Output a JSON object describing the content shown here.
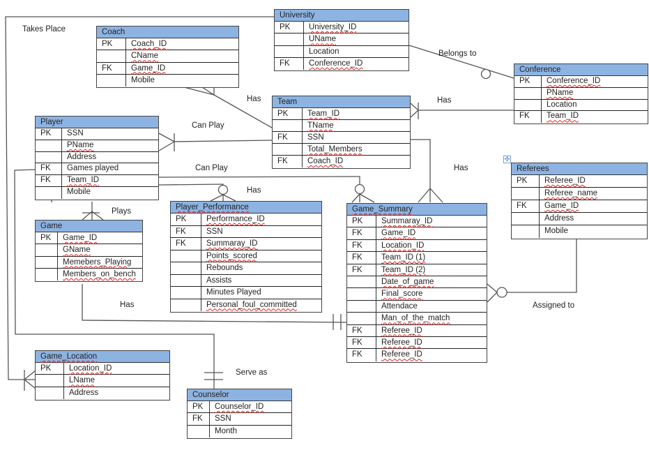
{
  "tables": [
    {
      "id": "university",
      "title": "University",
      "rows": [
        [
          "PK",
          "University_ID"
        ],
        [
          "",
          "UName"
        ],
        [
          "",
          "Location"
        ],
        [
          "FK",
          "Conference_ID"
        ]
      ]
    },
    {
      "id": "coach",
      "title": "Coach",
      "rows": [
        [
          "PK",
          "Coach_ID"
        ],
        [
          "",
          "CName"
        ],
        [
          "FK",
          "Game_ID"
        ],
        [
          "",
          "Mobile"
        ]
      ]
    },
    {
      "id": "conference",
      "title": "Conference",
      "rows": [
        [
          "PK",
          "Conference_ID"
        ],
        [
          "",
          "PName"
        ],
        [
          "",
          "Location"
        ],
        [
          "FK",
          "Team_ID"
        ]
      ]
    },
    {
      "id": "team",
      "title": "Team",
      "rows": [
        [
          "PK",
          "Team_ID"
        ],
        [
          "",
          "TName"
        ],
        [
          "FK",
          "SSN"
        ],
        [
          "",
          "Total_Members"
        ],
        [
          "FK",
          "Coach_ID"
        ]
      ]
    },
    {
      "id": "player",
      "title": "Player",
      "rows": [
        [
          "PK",
          "SSN"
        ],
        [
          "",
          "PName"
        ],
        [
          "",
          "Address"
        ],
        [
          "FK",
          "Games played"
        ],
        [
          "FK",
          "Team_ID"
        ],
        [
          "",
          "Mobile"
        ]
      ]
    },
    {
      "id": "referees",
      "title": "Referees",
      "rows": [
        [
          "PK",
          "Referee_ID"
        ],
        [
          "",
          "Referee_name"
        ],
        [
          "FK",
          "Game_ID"
        ],
        [
          "",
          "Address"
        ],
        [
          "",
          "Mobile"
        ]
      ]
    },
    {
      "id": "player-performance",
      "title": "Player_Performance",
      "rows": [
        [
          "PK",
          "Performance_ID"
        ],
        [
          "FK",
          "SSN"
        ],
        [
          "FK",
          "Summaray_ID"
        ],
        [
          "",
          "Points_scored"
        ],
        [
          "",
          "Rebounds"
        ],
        [
          "",
          "Assists"
        ],
        [
          "",
          "Minutes Played"
        ],
        [
          "",
          "Personal_foul_committed"
        ]
      ]
    },
    {
      "id": "game-summary",
      "title": "Game_Summary",
      "rows": [
        [
          "PK",
          "Summaray_ID"
        ],
        [
          "FK",
          "Game_ID"
        ],
        [
          "FK",
          "Location_ID"
        ],
        [
          "FK",
          "Team_ID (1)"
        ],
        [
          "FK",
          "Team_ID (2)"
        ],
        [
          "",
          "Date_of_game"
        ],
        [
          "",
          "Final_score"
        ],
        [
          "",
          "Attendace"
        ],
        [
          "",
          "Man_of_the_match"
        ],
        [
          "FK",
          "Referee_ID"
        ],
        [
          "FK",
          "Referee_ID"
        ],
        [
          "FK",
          "Referee_ID"
        ]
      ]
    },
    {
      "id": "game",
      "title": "Game",
      "rows": [
        [
          "PK",
          "Game_ID"
        ],
        [
          "",
          "GName"
        ],
        [
          "",
          "Memebers_Playing"
        ],
        [
          "",
          "Members_on_bench"
        ]
      ]
    },
    {
      "id": "game-location",
      "title": "Game_Location",
      "rows": [
        [
          "PK",
          "Location_ID"
        ],
        [
          "",
          "LName"
        ],
        [
          "",
          "Address"
        ]
      ]
    },
    {
      "id": "counselor",
      "title": "Counselor",
      "rows": [
        [
          "PK",
          "Counselor_ID"
        ],
        [
          "FK",
          "SSN"
        ],
        [
          "",
          "Month"
        ]
      ]
    }
  ],
  "relationships": {
    "takes_place": "Takes Place",
    "coach_team": "Has",
    "player_team": "Can Play",
    "player_summary": "Can Play",
    "player_performance": "Has",
    "university_conference": "Belongs to",
    "team_conference": "Has",
    "team_summary": "Has",
    "player_game": "Plays",
    "game_summary": "Has",
    "summary_referees": "Assigned to",
    "player_counselor": "Serve as"
  },
  "colors": {
    "header": "#8db3e2",
    "line": "#555555",
    "spellcheck": "#dd2222"
  },
  "icons": {
    "table_move": "move-handle-icon"
  }
}
